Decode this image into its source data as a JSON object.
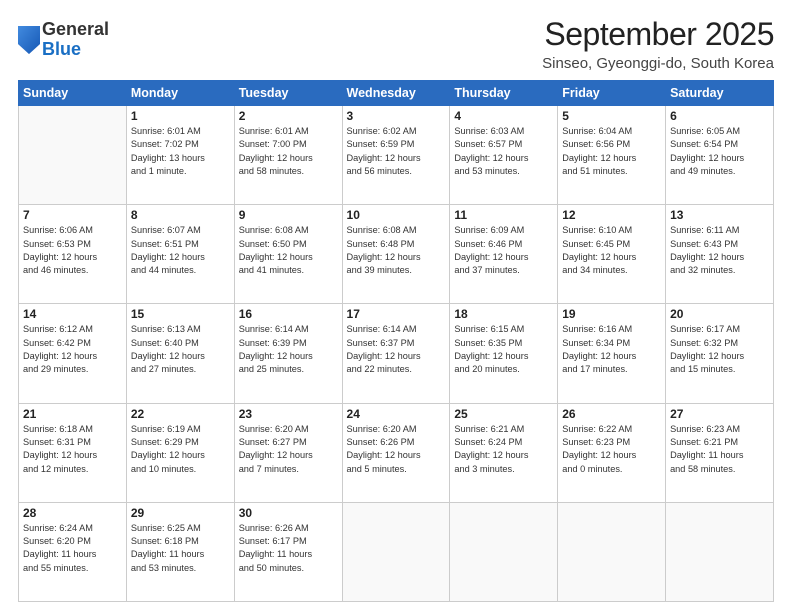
{
  "logo": {
    "general": "General",
    "blue": "Blue"
  },
  "header": {
    "month": "September 2025",
    "location": "Sinseo, Gyeonggi-do, South Korea"
  },
  "days": [
    "Sunday",
    "Monday",
    "Tuesday",
    "Wednesday",
    "Thursday",
    "Friday",
    "Saturday"
  ],
  "weeks": [
    [
      {
        "day": "",
        "info": ""
      },
      {
        "day": "1",
        "info": "Sunrise: 6:01 AM\nSunset: 7:02 PM\nDaylight: 13 hours\nand 1 minute."
      },
      {
        "day": "2",
        "info": "Sunrise: 6:01 AM\nSunset: 7:00 PM\nDaylight: 12 hours\nand 58 minutes."
      },
      {
        "day": "3",
        "info": "Sunrise: 6:02 AM\nSunset: 6:59 PM\nDaylight: 12 hours\nand 56 minutes."
      },
      {
        "day": "4",
        "info": "Sunrise: 6:03 AM\nSunset: 6:57 PM\nDaylight: 12 hours\nand 53 minutes."
      },
      {
        "day": "5",
        "info": "Sunrise: 6:04 AM\nSunset: 6:56 PM\nDaylight: 12 hours\nand 51 minutes."
      },
      {
        "day": "6",
        "info": "Sunrise: 6:05 AM\nSunset: 6:54 PM\nDaylight: 12 hours\nand 49 minutes."
      }
    ],
    [
      {
        "day": "7",
        "info": "Sunrise: 6:06 AM\nSunset: 6:53 PM\nDaylight: 12 hours\nand 46 minutes."
      },
      {
        "day": "8",
        "info": "Sunrise: 6:07 AM\nSunset: 6:51 PM\nDaylight: 12 hours\nand 44 minutes."
      },
      {
        "day": "9",
        "info": "Sunrise: 6:08 AM\nSunset: 6:50 PM\nDaylight: 12 hours\nand 41 minutes."
      },
      {
        "day": "10",
        "info": "Sunrise: 6:08 AM\nSunset: 6:48 PM\nDaylight: 12 hours\nand 39 minutes."
      },
      {
        "day": "11",
        "info": "Sunrise: 6:09 AM\nSunset: 6:46 PM\nDaylight: 12 hours\nand 37 minutes."
      },
      {
        "day": "12",
        "info": "Sunrise: 6:10 AM\nSunset: 6:45 PM\nDaylight: 12 hours\nand 34 minutes."
      },
      {
        "day": "13",
        "info": "Sunrise: 6:11 AM\nSunset: 6:43 PM\nDaylight: 12 hours\nand 32 minutes."
      }
    ],
    [
      {
        "day": "14",
        "info": "Sunrise: 6:12 AM\nSunset: 6:42 PM\nDaylight: 12 hours\nand 29 minutes."
      },
      {
        "day": "15",
        "info": "Sunrise: 6:13 AM\nSunset: 6:40 PM\nDaylight: 12 hours\nand 27 minutes."
      },
      {
        "day": "16",
        "info": "Sunrise: 6:14 AM\nSunset: 6:39 PM\nDaylight: 12 hours\nand 25 minutes."
      },
      {
        "day": "17",
        "info": "Sunrise: 6:14 AM\nSunset: 6:37 PM\nDaylight: 12 hours\nand 22 minutes."
      },
      {
        "day": "18",
        "info": "Sunrise: 6:15 AM\nSunset: 6:35 PM\nDaylight: 12 hours\nand 20 minutes."
      },
      {
        "day": "19",
        "info": "Sunrise: 6:16 AM\nSunset: 6:34 PM\nDaylight: 12 hours\nand 17 minutes."
      },
      {
        "day": "20",
        "info": "Sunrise: 6:17 AM\nSunset: 6:32 PM\nDaylight: 12 hours\nand 15 minutes."
      }
    ],
    [
      {
        "day": "21",
        "info": "Sunrise: 6:18 AM\nSunset: 6:31 PM\nDaylight: 12 hours\nand 12 minutes."
      },
      {
        "day": "22",
        "info": "Sunrise: 6:19 AM\nSunset: 6:29 PM\nDaylight: 12 hours\nand 10 minutes."
      },
      {
        "day": "23",
        "info": "Sunrise: 6:20 AM\nSunset: 6:27 PM\nDaylight: 12 hours\nand 7 minutes."
      },
      {
        "day": "24",
        "info": "Sunrise: 6:20 AM\nSunset: 6:26 PM\nDaylight: 12 hours\nand 5 minutes."
      },
      {
        "day": "25",
        "info": "Sunrise: 6:21 AM\nSunset: 6:24 PM\nDaylight: 12 hours\nand 3 minutes."
      },
      {
        "day": "26",
        "info": "Sunrise: 6:22 AM\nSunset: 6:23 PM\nDaylight: 12 hours\nand 0 minutes."
      },
      {
        "day": "27",
        "info": "Sunrise: 6:23 AM\nSunset: 6:21 PM\nDaylight: 11 hours\nand 58 minutes."
      }
    ],
    [
      {
        "day": "28",
        "info": "Sunrise: 6:24 AM\nSunset: 6:20 PM\nDaylight: 11 hours\nand 55 minutes."
      },
      {
        "day": "29",
        "info": "Sunrise: 6:25 AM\nSunset: 6:18 PM\nDaylight: 11 hours\nand 53 minutes."
      },
      {
        "day": "30",
        "info": "Sunrise: 6:26 AM\nSunset: 6:17 PM\nDaylight: 11 hours\nand 50 minutes."
      },
      {
        "day": "",
        "info": ""
      },
      {
        "day": "",
        "info": ""
      },
      {
        "day": "",
        "info": ""
      },
      {
        "day": "",
        "info": ""
      }
    ]
  ]
}
